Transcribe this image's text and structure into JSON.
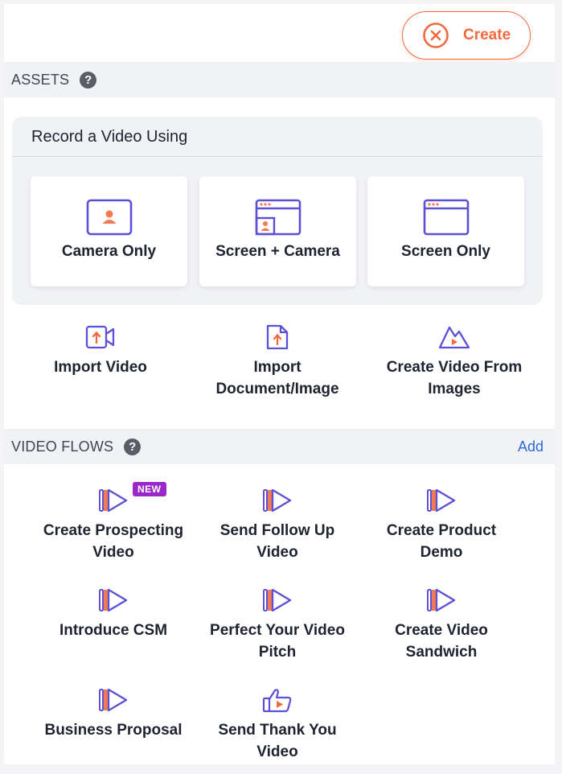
{
  "header": {
    "create_label": "Create"
  },
  "assets": {
    "title": "ASSETS",
    "help": "?",
    "record": {
      "title": "Record a Video Using",
      "options": [
        {
          "label": "Camera Only",
          "icon": "camera-icon"
        },
        {
          "label": "Screen + Camera",
          "icon": "screen-camera-icon"
        },
        {
          "label": "Screen Only",
          "icon": "screen-icon"
        }
      ]
    },
    "imports": [
      {
        "line1": "Import Video",
        "line2": "",
        "icon": "import-video-icon"
      },
      {
        "line1": "Import",
        "line2": "Document/Image",
        "icon": "import-document-icon"
      },
      {
        "line1": "Create Video From",
        "line2": "Images",
        "icon": "images-icon"
      }
    ]
  },
  "video_flows": {
    "title": "VIDEO FLOWS",
    "help": "?",
    "add_label": "Add",
    "new_badge": "NEW",
    "items": [
      {
        "line1": "Create Prospecting",
        "line2": "Video",
        "icon": "video-flow-icon"
      },
      {
        "line1": "Send Follow Up",
        "line2": "Video",
        "icon": "video-flow-icon"
      },
      {
        "line1": "Create Product",
        "line2": "Demo",
        "icon": "video-flow-icon"
      },
      {
        "line1": "Introduce CSM",
        "line2": "",
        "icon": "video-flow-icon"
      },
      {
        "line1": "Perfect Your Video",
        "line2": "Pitch",
        "icon": "video-flow-icon"
      },
      {
        "line1": "Create Video",
        "line2": "Sandwich",
        "icon": "video-flow-icon"
      },
      {
        "line1": "Business Proposal",
        "line2": "",
        "icon": "video-flow-icon"
      },
      {
        "line1": "Send Thank You",
        "line2": "Video",
        "icon": "thumbs-up-video-icon"
      }
    ]
  },
  "colors": {
    "accent": "#f06a3e",
    "icon_purple": "#5b50d6",
    "link_blue": "#2e69d6",
    "badge_purple": "#9b27c8",
    "section_bg": "#f1f2f6"
  }
}
